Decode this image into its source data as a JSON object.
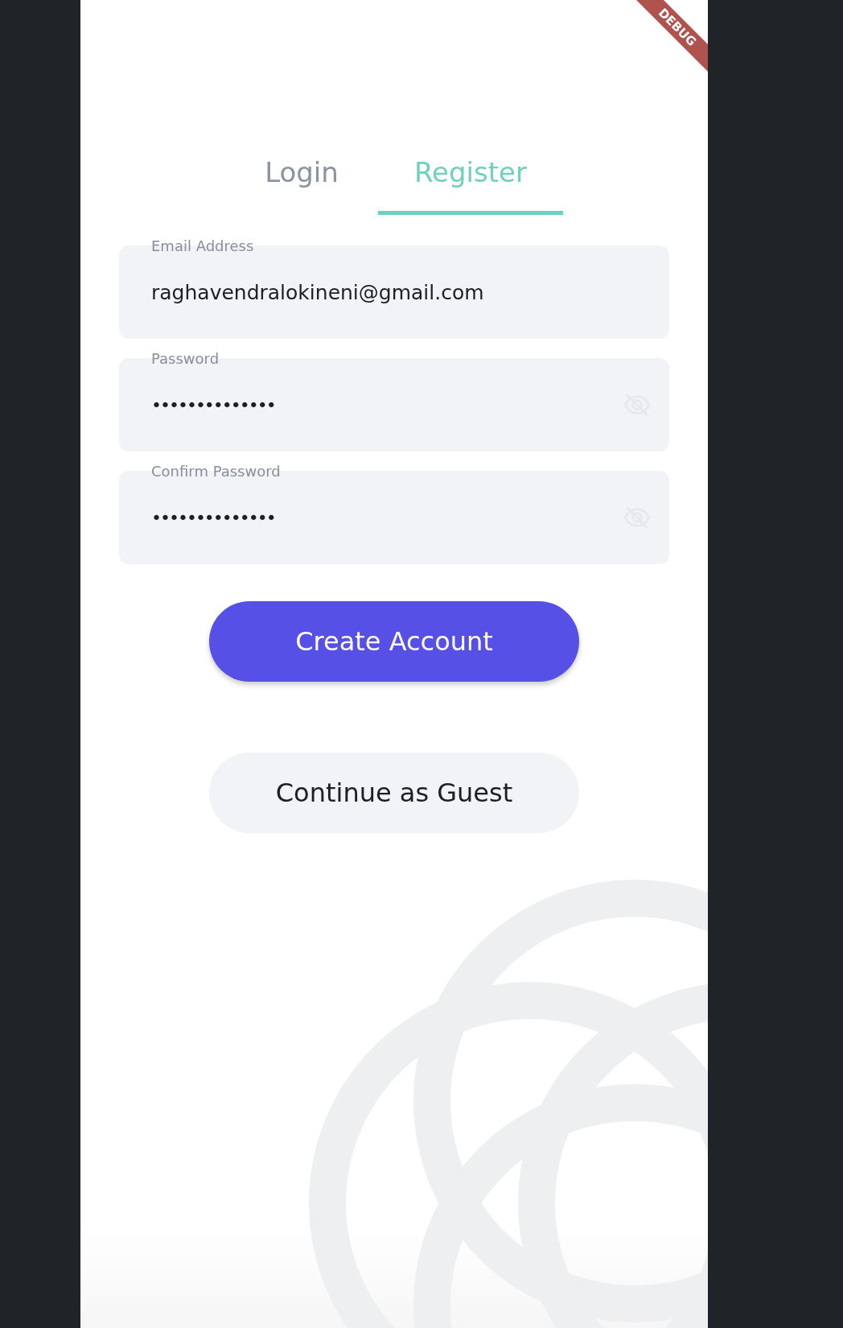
{
  "debug_banner": "DEBUG",
  "tabs": [
    {
      "label": "Login",
      "selected": false
    },
    {
      "label": "Register",
      "selected": true
    }
  ],
  "fields": [
    {
      "label": "Email Address",
      "value": "raghavendralokineni@gmail.com",
      "kind": "text"
    },
    {
      "label": "Password",
      "value": "••••••••••••••",
      "kind": "password"
    },
    {
      "label": "Confirm Password",
      "value": "••••••••••••••",
      "kind": "password"
    }
  ],
  "buttons": [
    {
      "label": "Create Account",
      "kind": "primary"
    },
    {
      "label": "Continue as Guest",
      "kind": "secondary"
    }
  ]
}
